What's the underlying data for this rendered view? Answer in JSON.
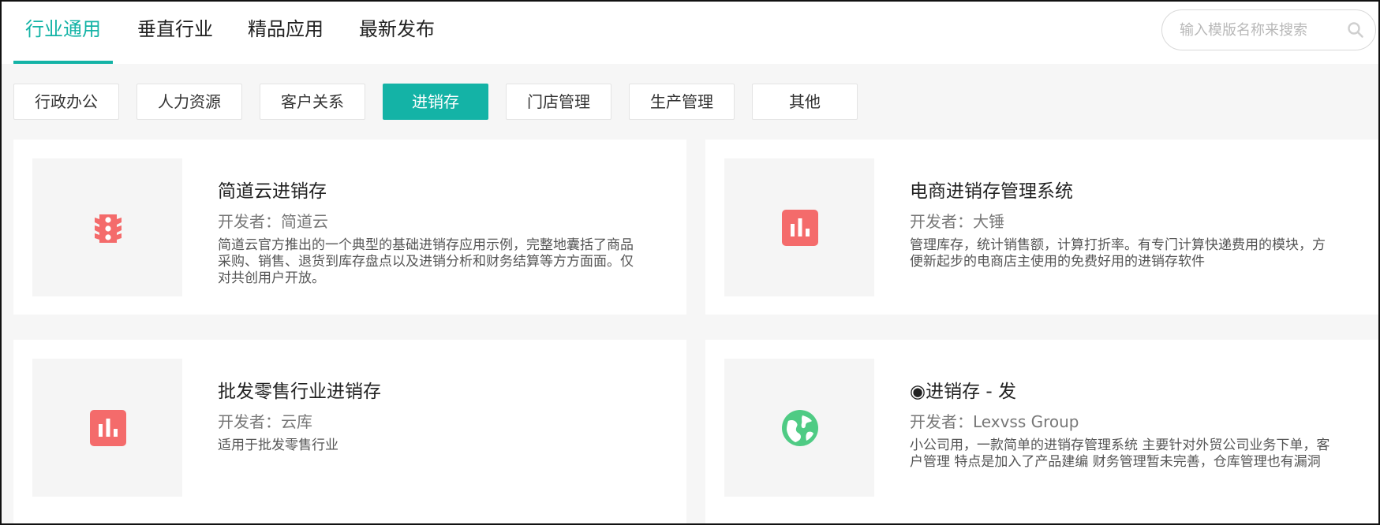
{
  "tabs": [
    {
      "label": "行业通用",
      "active": true
    },
    {
      "label": "垂直行业",
      "active": false
    },
    {
      "label": "精品应用",
      "active": false
    },
    {
      "label": "最新发布",
      "active": false
    }
  ],
  "search": {
    "placeholder": "输入模版名称来搜索",
    "icon": "search-icon"
  },
  "categories": [
    {
      "label": "行政办公"
    },
    {
      "label": "人力资源"
    },
    {
      "label": "客户关系"
    },
    {
      "label": "进销存",
      "active": true
    },
    {
      "label": "门店管理"
    },
    {
      "label": "生产管理"
    },
    {
      "label": "其他"
    }
  ],
  "apps": [
    {
      "title": "简道云进销存",
      "developer": "开发者：简道云",
      "description": "简道云官方推出的一个典型的基础进销存应用示例，完整地囊括了商品采购、销售、退货到库存盘点以及进销分析和财务结算等方方面面。仅对共创用户开放。",
      "icon": "traffic-light-icon",
      "icon_color": "#f46b6b"
    },
    {
      "title": "电商进销存管理系统",
      "developer": "开发者：大锤",
      "description": "管理库存，统计销售额，计算打折率。有专门计算快递费用的模块，方便新起步的电商店主使用的免费好用的进销存软件",
      "icon": "bar-chart-icon",
      "icon_color": "#f46b6b"
    },
    {
      "title": "批发零售行业进销存",
      "developer": "开发者：云库",
      "description": "适用于批发零售行业",
      "icon": "bar-chart-icon",
      "icon_color": "#f46b6b"
    },
    {
      "title": "◉进销存 - 发",
      "developer": "开发者：Lexvss Group",
      "description": "小公司用，一款简单的进销存管理系统 主要针对外贸公司业务下单，客户管理 特点是加入了产品建编 财务管理暂未完善，仓库管理也有漏洞",
      "icon": "globe-icon",
      "icon_color": "#4fcb84"
    }
  ],
  "colors": {
    "accent": "#14b3a6",
    "text": "#222222",
    "muted": "#777777"
  }
}
